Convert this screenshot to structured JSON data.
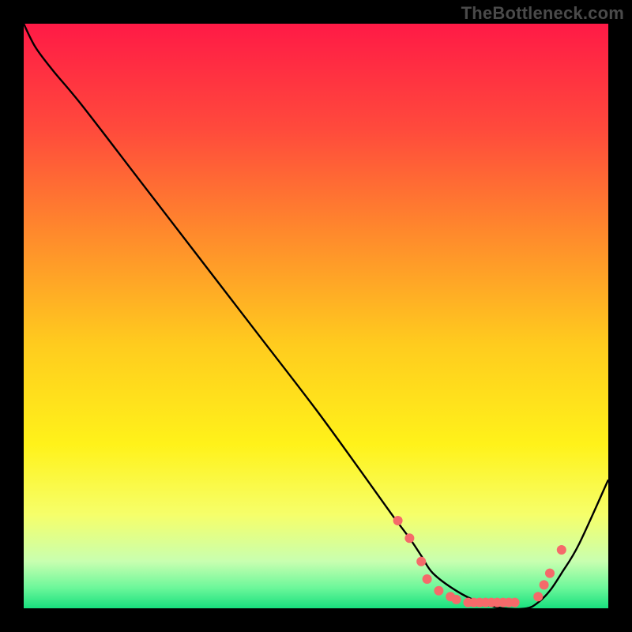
{
  "watermark": "TheBottleneck.com",
  "chart_data": {
    "type": "line",
    "title": "",
    "xlabel": "",
    "ylabel": "",
    "xlim": [
      0,
      100
    ],
    "ylim": [
      0,
      100
    ],
    "grid": false,
    "background_gradient": {
      "orientation": "vertical",
      "stops": [
        {
          "offset": 0.0,
          "color": "#ff1a46"
        },
        {
          "offset": 0.18,
          "color": "#ff4a3c"
        },
        {
          "offset": 0.36,
          "color": "#ff8a2c"
        },
        {
          "offset": 0.55,
          "color": "#ffcc1e"
        },
        {
          "offset": 0.72,
          "color": "#fff21a"
        },
        {
          "offset": 0.84,
          "color": "#f6ff6a"
        },
        {
          "offset": 0.92,
          "color": "#c8ffb0"
        },
        {
          "offset": 0.965,
          "color": "#6cf79a"
        },
        {
          "offset": 1.0,
          "color": "#18e07e"
        }
      ]
    },
    "series": [
      {
        "name": "bottleneck-curve",
        "color": "#000000",
        "x": [
          0,
          2,
          5,
          10,
          20,
          30,
          40,
          50,
          58,
          63,
          66,
          68,
          70,
          74,
          78,
          82,
          86,
          88,
          90,
          92,
          95,
          100
        ],
        "y": [
          100,
          96,
          92,
          86,
          73,
          60,
          47,
          34,
          23,
          16,
          12,
          9,
          6,
          3,
          1,
          0,
          0,
          1,
          3,
          6,
          11,
          22
        ]
      }
    ],
    "markers": {
      "name": "highlight-dots",
      "color": "#f56a6a",
      "radius": 6,
      "points": [
        {
          "x": 64,
          "y": 15
        },
        {
          "x": 66,
          "y": 12
        },
        {
          "x": 68,
          "y": 8
        },
        {
          "x": 69,
          "y": 5
        },
        {
          "x": 71,
          "y": 3
        },
        {
          "x": 73,
          "y": 2
        },
        {
          "x": 74,
          "y": 1.5
        },
        {
          "x": 76,
          "y": 1
        },
        {
          "x": 77,
          "y": 1
        },
        {
          "x": 78,
          "y": 1
        },
        {
          "x": 79,
          "y": 1
        },
        {
          "x": 80,
          "y": 1
        },
        {
          "x": 81,
          "y": 1
        },
        {
          "x": 82,
          "y": 1
        },
        {
          "x": 83,
          "y": 1
        },
        {
          "x": 84,
          "y": 1
        },
        {
          "x": 88,
          "y": 2
        },
        {
          "x": 89,
          "y": 4
        },
        {
          "x": 90,
          "y": 6
        },
        {
          "x": 92,
          "y": 10
        }
      ]
    }
  }
}
